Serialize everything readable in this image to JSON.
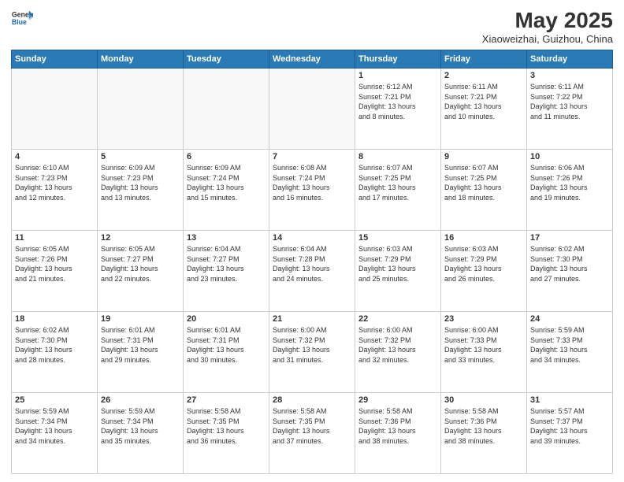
{
  "header": {
    "logo_line1": "General",
    "logo_line2": "Blue",
    "month": "May 2025",
    "location": "Xiaoweizhai, Guizhou, China"
  },
  "days_of_week": [
    "Sunday",
    "Monday",
    "Tuesday",
    "Wednesday",
    "Thursday",
    "Friday",
    "Saturday"
  ],
  "weeks": [
    [
      {
        "day": "",
        "info": ""
      },
      {
        "day": "",
        "info": ""
      },
      {
        "day": "",
        "info": ""
      },
      {
        "day": "",
        "info": ""
      },
      {
        "day": "1",
        "info": "Sunrise: 6:12 AM\nSunset: 7:21 PM\nDaylight: 13 hours\nand 8 minutes."
      },
      {
        "day": "2",
        "info": "Sunrise: 6:11 AM\nSunset: 7:21 PM\nDaylight: 13 hours\nand 10 minutes."
      },
      {
        "day": "3",
        "info": "Sunrise: 6:11 AM\nSunset: 7:22 PM\nDaylight: 13 hours\nand 11 minutes."
      }
    ],
    [
      {
        "day": "4",
        "info": "Sunrise: 6:10 AM\nSunset: 7:23 PM\nDaylight: 13 hours\nand 12 minutes."
      },
      {
        "day": "5",
        "info": "Sunrise: 6:09 AM\nSunset: 7:23 PM\nDaylight: 13 hours\nand 13 minutes."
      },
      {
        "day": "6",
        "info": "Sunrise: 6:09 AM\nSunset: 7:24 PM\nDaylight: 13 hours\nand 15 minutes."
      },
      {
        "day": "7",
        "info": "Sunrise: 6:08 AM\nSunset: 7:24 PM\nDaylight: 13 hours\nand 16 minutes."
      },
      {
        "day": "8",
        "info": "Sunrise: 6:07 AM\nSunset: 7:25 PM\nDaylight: 13 hours\nand 17 minutes."
      },
      {
        "day": "9",
        "info": "Sunrise: 6:07 AM\nSunset: 7:25 PM\nDaylight: 13 hours\nand 18 minutes."
      },
      {
        "day": "10",
        "info": "Sunrise: 6:06 AM\nSunset: 7:26 PM\nDaylight: 13 hours\nand 19 minutes."
      }
    ],
    [
      {
        "day": "11",
        "info": "Sunrise: 6:05 AM\nSunset: 7:26 PM\nDaylight: 13 hours\nand 21 minutes."
      },
      {
        "day": "12",
        "info": "Sunrise: 6:05 AM\nSunset: 7:27 PM\nDaylight: 13 hours\nand 22 minutes."
      },
      {
        "day": "13",
        "info": "Sunrise: 6:04 AM\nSunset: 7:27 PM\nDaylight: 13 hours\nand 23 minutes."
      },
      {
        "day": "14",
        "info": "Sunrise: 6:04 AM\nSunset: 7:28 PM\nDaylight: 13 hours\nand 24 minutes."
      },
      {
        "day": "15",
        "info": "Sunrise: 6:03 AM\nSunset: 7:29 PM\nDaylight: 13 hours\nand 25 minutes."
      },
      {
        "day": "16",
        "info": "Sunrise: 6:03 AM\nSunset: 7:29 PM\nDaylight: 13 hours\nand 26 minutes."
      },
      {
        "day": "17",
        "info": "Sunrise: 6:02 AM\nSunset: 7:30 PM\nDaylight: 13 hours\nand 27 minutes."
      }
    ],
    [
      {
        "day": "18",
        "info": "Sunrise: 6:02 AM\nSunset: 7:30 PM\nDaylight: 13 hours\nand 28 minutes."
      },
      {
        "day": "19",
        "info": "Sunrise: 6:01 AM\nSunset: 7:31 PM\nDaylight: 13 hours\nand 29 minutes."
      },
      {
        "day": "20",
        "info": "Sunrise: 6:01 AM\nSunset: 7:31 PM\nDaylight: 13 hours\nand 30 minutes."
      },
      {
        "day": "21",
        "info": "Sunrise: 6:00 AM\nSunset: 7:32 PM\nDaylight: 13 hours\nand 31 minutes."
      },
      {
        "day": "22",
        "info": "Sunrise: 6:00 AM\nSunset: 7:32 PM\nDaylight: 13 hours\nand 32 minutes."
      },
      {
        "day": "23",
        "info": "Sunrise: 6:00 AM\nSunset: 7:33 PM\nDaylight: 13 hours\nand 33 minutes."
      },
      {
        "day": "24",
        "info": "Sunrise: 5:59 AM\nSunset: 7:33 PM\nDaylight: 13 hours\nand 34 minutes."
      }
    ],
    [
      {
        "day": "25",
        "info": "Sunrise: 5:59 AM\nSunset: 7:34 PM\nDaylight: 13 hours\nand 34 minutes."
      },
      {
        "day": "26",
        "info": "Sunrise: 5:59 AM\nSunset: 7:34 PM\nDaylight: 13 hours\nand 35 minutes."
      },
      {
        "day": "27",
        "info": "Sunrise: 5:58 AM\nSunset: 7:35 PM\nDaylight: 13 hours\nand 36 minutes."
      },
      {
        "day": "28",
        "info": "Sunrise: 5:58 AM\nSunset: 7:35 PM\nDaylight: 13 hours\nand 37 minutes."
      },
      {
        "day": "29",
        "info": "Sunrise: 5:58 AM\nSunset: 7:36 PM\nDaylight: 13 hours\nand 38 minutes."
      },
      {
        "day": "30",
        "info": "Sunrise: 5:58 AM\nSunset: 7:36 PM\nDaylight: 13 hours\nand 38 minutes."
      },
      {
        "day": "31",
        "info": "Sunrise: 5:57 AM\nSunset: 7:37 PM\nDaylight: 13 hours\nand 39 minutes."
      }
    ]
  ]
}
